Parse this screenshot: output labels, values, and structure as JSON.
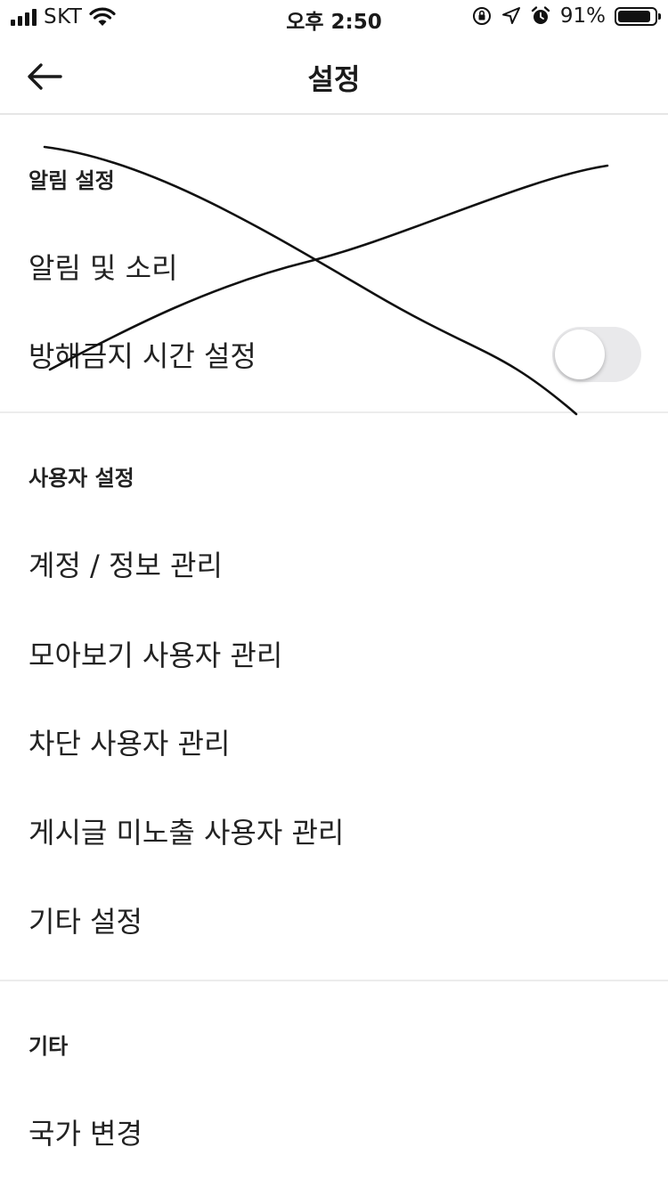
{
  "status_bar": {
    "carrier": "SKT",
    "time": "오후 2:50",
    "battery_percent": "91%",
    "battery_level": 0.91,
    "icons": [
      "signal-icon",
      "wifi-icon",
      "orientation-lock-icon",
      "location-icon",
      "alarm-icon",
      "battery-icon"
    ]
  },
  "nav": {
    "title": "설정",
    "back_icon": "arrow-left-icon"
  },
  "sections": {
    "notifications": {
      "header": "알림 설정",
      "items": [
        {
          "label": "알림 및 소리"
        },
        {
          "label": "방해금지 시간 설정",
          "toggle_on": false
        }
      ]
    },
    "user": {
      "header": "사용자 설정",
      "items": [
        {
          "label": "계정 / 정보 관리"
        },
        {
          "label": "모아보기 사용자 관리"
        },
        {
          "label": "차단 사용자 관리"
        },
        {
          "label": "게시글 미노출 사용자 관리"
        },
        {
          "label": "기타 설정"
        }
      ]
    },
    "other": {
      "header": "기타",
      "items": [
        {
          "label": "국가 변경"
        }
      ]
    }
  },
  "colors": {
    "text": "#222222",
    "divider": "#ececec",
    "toggle_off": "#e9e9eb",
    "background": "#ffffff"
  }
}
